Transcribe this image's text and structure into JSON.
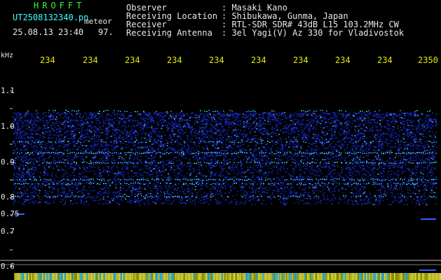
{
  "header": {
    "title": "HROFFT",
    "filename": "UT2508132340.pn",
    "mode": "meteor",
    "datetime": "25.08.13 23:40",
    "count": "97.",
    "meta": [
      {
        "label": "Observer",
        "value": ": Masaki Kano"
      },
      {
        "label": "Receiving Location",
        "value": ": Shibukawa, Gunma, Japan"
      },
      {
        "label": "Receiver",
        "value": ": RTL-SDR SDR# 43dB L15 103.2MHz CW"
      },
      {
        "label": "Receiving Antenna",
        "value": ": 3el Yagi(V) Az 330 for Vladivostok"
      }
    ]
  },
  "axis": {
    "unit": "kHz",
    "x_ticks": [
      "234",
      "234",
      "234",
      "234",
      "234",
      "234",
      "234",
      "234",
      "234",
      "2350"
    ],
    "y_ticks": [
      "1.1",
      "1.0",
      "0.9",
      "0.8",
      "0.75",
      "0.7",
      "0.6"
    ]
  },
  "colors": {
    "background": "#000000",
    "noise": "#1a2fd0",
    "signal": "#40ffff",
    "title": "#30ff30",
    "ticks": "#e8e800",
    "bottom_bar": "#ffff40"
  }
}
